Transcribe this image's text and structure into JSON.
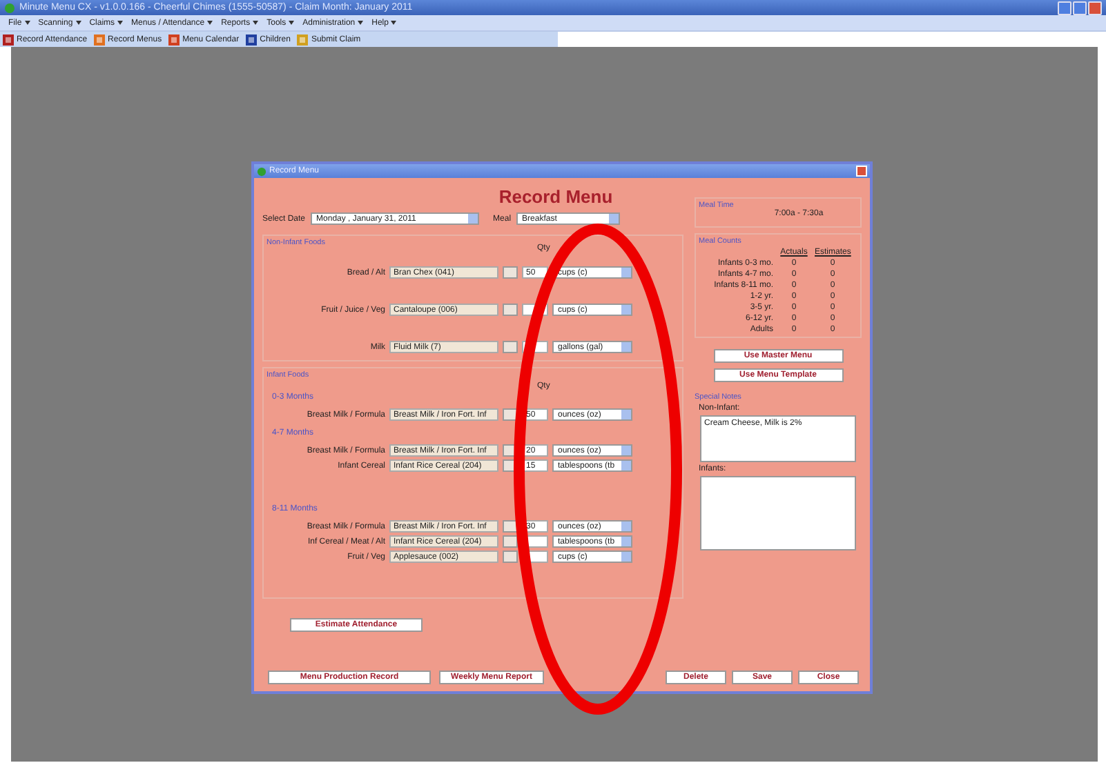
{
  "app": {
    "title": "Minute Menu CX - v1.0.0.166 - Cheerful Chimes (1555-50587) - Claim Month: January 2011",
    "menu": [
      "File",
      "Scanning",
      "Claims",
      "Menus / Attendance",
      "Reports",
      "Tools",
      "Administration",
      "Help"
    ],
    "toolbar": [
      {
        "label": "Record Attendance",
        "kind": "attendance"
      },
      {
        "label": "Record Menus",
        "kind": "menus"
      },
      {
        "label": "Menu Calendar",
        "kind": "calendar"
      },
      {
        "label": "Children",
        "kind": "children"
      },
      {
        "label": "Submit Claim",
        "kind": "claim"
      }
    ]
  },
  "dialog": {
    "title": "Record Menu",
    "heading": "Record Menu",
    "select_date": {
      "label": "Select Date",
      "value": "Monday , January 31, 2011"
    },
    "meal": {
      "label": "Meal",
      "value": "Breakfast"
    },
    "non_infant": {
      "title": "Non-Infant Foods",
      "qty_label": "Qty",
      "rows": [
        {
          "label": "Bread / Alt",
          "food": "Bran Chex (041)",
          "qty": "50",
          "unit": "cups (c)"
        },
        {
          "label": "Fruit / Juice / Veg",
          "food": "Cantaloupe (006)",
          "unit": "cups (c)"
        },
        {
          "label": "Milk",
          "food": "Fluid Milk (7)",
          "unit": "gallons (gal)"
        }
      ]
    },
    "infant": {
      "title": "Infant Foods",
      "qty_label": "Qty",
      "groups": [
        {
          "title": "0-3 Months",
          "rows": [
            {
              "label": "Breast Milk / Formula",
              "food": "Breast Milk / Iron Fort. Inf",
              "qty": "50",
              "unit": "ounces (oz)"
            }
          ]
        },
        {
          "title": "4-7 Months",
          "rows": [
            {
              "label": "Breast Milk / Formula",
              "food": "Breast Milk / Iron Fort. Inf",
              "qty": "20",
              "unit": "ounces (oz)"
            },
            {
              "label": "Infant Cereal",
              "food": "Infant Rice Cereal (204)",
              "qty": "15",
              "unit": "tablespoons (tb"
            }
          ]
        },
        {
          "title": "8-11 Months",
          "rows": [
            {
              "label": "Breast Milk / Formula",
              "food": "Breast Milk / Iron Fort. Inf",
              "qty": "30",
              "unit": "ounces (oz)"
            },
            {
              "label": "Inf Cereal / Meat / Alt",
              "food": "Infant Rice Cereal (204)",
              "unit": "tablespoons (tb"
            },
            {
              "label": "Fruit / Veg",
              "food": "Applesauce (002)",
              "unit": "cups (c)"
            }
          ]
        }
      ]
    },
    "meal_time": {
      "title": "Meal Time",
      "value": "7:00a - 7:30a"
    },
    "counts": {
      "title": "Meal Counts",
      "columns": [
        "Actuals",
        "Estimates"
      ],
      "rows": [
        {
          "label": "Infants 0-3 mo.",
          "actual": "0",
          "estimate": "0"
        },
        {
          "label": "Infants 4-7 mo.",
          "actual": "0",
          "estimate": "0"
        },
        {
          "label": "Infants 8-11 mo.",
          "actual": "0",
          "estimate": "0"
        },
        {
          "label": "1-2 yr.",
          "actual": "0",
          "estimate": "0"
        },
        {
          "label": "3-5 yr.",
          "actual": "0",
          "estimate": "0"
        },
        {
          "label": "6-12 yr.",
          "actual": "0",
          "estimate": "0"
        },
        {
          "label": "Adults",
          "actual": "0",
          "estimate": "0"
        }
      ]
    },
    "side_buttons": [
      "Use Master Menu",
      "Use Menu Template"
    ],
    "notes": {
      "title": "Special Notes",
      "non_infant_label": "Non-Infant:",
      "non_infant_text": "Cream Cheese, Milk is 2%",
      "infants_label": "Infants:"
    },
    "estimate_button": "Estimate Attendance",
    "bottom_left": [
      "Menu Production Record",
      "Weekly Menu Report"
    ],
    "bottom_right": [
      "Delete",
      "Save",
      "Close"
    ]
  }
}
